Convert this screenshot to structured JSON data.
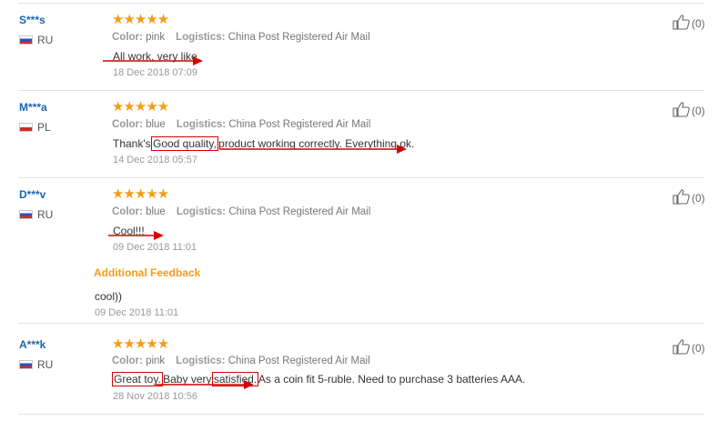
{
  "reviews": [
    {
      "user": "S***s",
      "country": "RU",
      "flag": "ru",
      "stars": "★★★★★",
      "color_label": "Color:",
      "color_value": "pink",
      "logistics_label": "Logistics:",
      "logistics_value": "China Post Registered Air Mail",
      "text": "All work, very like",
      "date": "18 Dec 2018 07:09",
      "likes": "(0)"
    },
    {
      "user": "M***a",
      "country": "PL",
      "flag": "pl",
      "stars": "★★★★★",
      "color_label": "Color:",
      "color_value": "blue",
      "logistics_label": "Logistics:",
      "logistics_value": "China Post Registered Air Mail",
      "text_pre": "Thank's ",
      "text_hl": "Good quality,",
      "text_post": " product working correctly. Everything ok.",
      "date": "14 Dec 2018 05:57",
      "likes": "(0)"
    },
    {
      "user": "D***v",
      "country": "RU",
      "flag": "ru",
      "stars": "★★★★★",
      "color_label": "Color:",
      "color_value": "blue",
      "logistics_label": "Logistics:",
      "logistics_value": "China Post Registered Air Mail",
      "text": "Cool!!!",
      "date": "09 Dec 2018 11:01",
      "likes": "(0)",
      "additional": {
        "title": "Additional Feedback",
        "text": "cool))",
        "date": "09 Dec 2018 11:01"
      }
    },
    {
      "user": "A***k",
      "country": "RU",
      "flag": "ru",
      "stars": "★★★★★",
      "color_label": "Color:",
      "color_value": "pink",
      "logistics_label": "Logistics:",
      "logistics_value": "China Post Registered Air Mail",
      "text_hl1": "Great toy.",
      "text_mid": " Baby very ",
      "text_hl2": "satisfied.",
      "text_post": " As a coin fit 5-ruble. Need to purchase 3 batteries AAA.",
      "date": "28 Nov 2018 10:56",
      "likes": "(0)"
    }
  ],
  "colors": {
    "username": "#1c64b4",
    "stars": "#f39d17",
    "annotation": "#d40000"
  },
  "icons": {
    "like": "thumbs-up-icon"
  }
}
